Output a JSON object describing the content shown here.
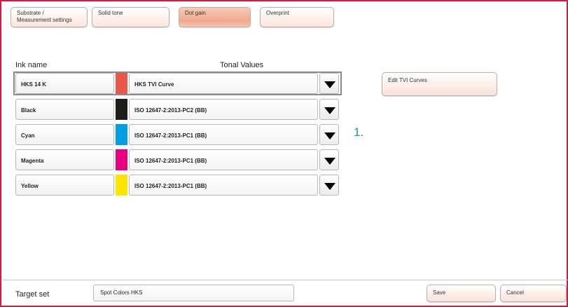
{
  "tabs": [
    {
      "label": "Substrate /\nMeasurement settings",
      "active": false
    },
    {
      "label": "Solid tone",
      "active": false
    },
    {
      "label": "Dot gain",
      "active": true
    },
    {
      "label": "Overprint",
      "active": false
    }
  ],
  "headers": {
    "ink_name": "Ink name",
    "tonal_values": "Tonal Values"
  },
  "inks": [
    {
      "name": "HKS 14 K",
      "color": "#e8594a",
      "curve": "HKS TVI Curve",
      "selected": true
    },
    {
      "name": "Black",
      "color": "#1d1d1b",
      "curve": "ISO 12647-2:2013-PC2 (BB)",
      "selected": false
    },
    {
      "name": "Cyan",
      "color": "#009fe3",
      "curve": "ISO 12647-2:2013-PC1 (BB)",
      "selected": false
    },
    {
      "name": "Magenta",
      "color": "#e6007e",
      "curve": "ISO 12647-2:2013-PC1 (BB)",
      "selected": false
    },
    {
      "name": "Yellow",
      "color": "#ffe500",
      "curve": "ISO 12647-2:2013-PC1 (BB)",
      "selected": false
    }
  ],
  "annotation": "1.",
  "edit_tvi_label": "Edit TVI Curves",
  "footer": {
    "target_set_label": "Target set",
    "target_set_value": "Spot Colors HKS",
    "save_label": "Save",
    "cancel_label": "Cancel"
  },
  "colors": {
    "frame_border": "#d51c3c",
    "annotation": "#1aa191",
    "active_tab": "#f2aa8f"
  }
}
